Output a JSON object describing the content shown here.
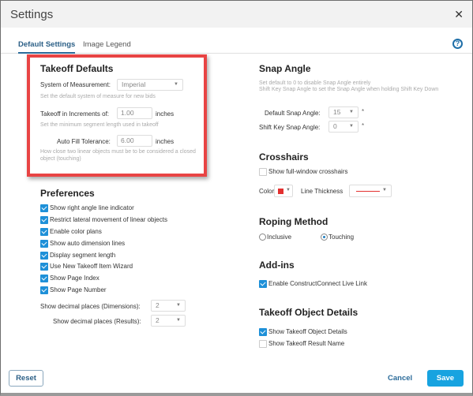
{
  "window": {
    "title": "Settings",
    "close_icon": "close-icon (×)",
    "close_glyph": "✕"
  },
  "tabs": [
    {
      "label": "Default Settings",
      "active": true
    },
    {
      "label": "Image Legend",
      "active": false
    }
  ],
  "help_glyph": "?",
  "takeoff_defaults": {
    "heading": "Takeoff Defaults",
    "system_label": "System of Measurement:",
    "system_value": "Imperial",
    "system_hint": "Set the default system of measure for new bids",
    "increments_label": "Takeoff in Increments of:",
    "increments_value": "1.00",
    "increments_unit": "inches",
    "increments_hint": "Set the minimum segment length used in takeoff",
    "autofill_label": "Auto Fill Tolerance:",
    "autofill_value": "6.00",
    "autofill_unit": "inches",
    "autofill_hint": "How close two linear objects must be to be considered a closed object (touching)"
  },
  "preferences": {
    "heading": "Preferences",
    "items": [
      {
        "label": "Show right angle line indicator",
        "checked": true
      },
      {
        "label": "Restrict lateral movement of linear objects",
        "checked": true
      },
      {
        "label": "Enable color plans",
        "checked": true
      },
      {
        "label": "Show auto dimension lines",
        "checked": true
      },
      {
        "label": "Display segment length",
        "checked": true
      },
      {
        "label": "Use New Takeoff Item Wizard",
        "checked": true
      },
      {
        "label": "Show Page Index",
        "checked": true
      },
      {
        "label": "Show Page Number",
        "checked": true
      }
    ],
    "decimal_dimensions_label": "Show decimal places (Dimensions):",
    "decimal_dimensions_value": "2",
    "decimal_results_label": "Show decimal places (Results):",
    "decimal_results_value": "2"
  },
  "snap_angle": {
    "heading": "Snap Angle",
    "hint_line1": "Set default to 0 to disable Snap Angle entirely",
    "hint_line2": "Shift Key Snap Angle to set the Snap Angle when holding Shift Key Down",
    "default_label": "Default Snap Angle:",
    "default_value": "15",
    "shift_label": "Shift Key Snap Angle:",
    "shift_value": "0",
    "required_marker": "*"
  },
  "crosshairs": {
    "heading": "Crosshairs",
    "full_window_label": "Show full-window crosshairs",
    "full_window_checked": false,
    "color_label": "Color",
    "color_value": "#e3302f",
    "thickness_label": "Line Thickness"
  },
  "roping": {
    "heading": "Roping Method",
    "options": [
      {
        "label": "Inclusive",
        "selected": false
      },
      {
        "label": "Touching",
        "selected": true
      }
    ]
  },
  "addins": {
    "heading": "Add-ins",
    "live_link_label": "Enable ConstructConnect Live Link",
    "live_link_checked": true
  },
  "object_details": {
    "heading": "Takeoff Object Details",
    "items": [
      {
        "label": "Show Takeoff Object Details",
        "checked": true
      },
      {
        "label": "Show Takeoff Result Name",
        "checked": false
      }
    ]
  },
  "footer": {
    "reset": "Reset",
    "cancel": "Cancel",
    "save": "Save"
  },
  "caret_glyph": "▼"
}
